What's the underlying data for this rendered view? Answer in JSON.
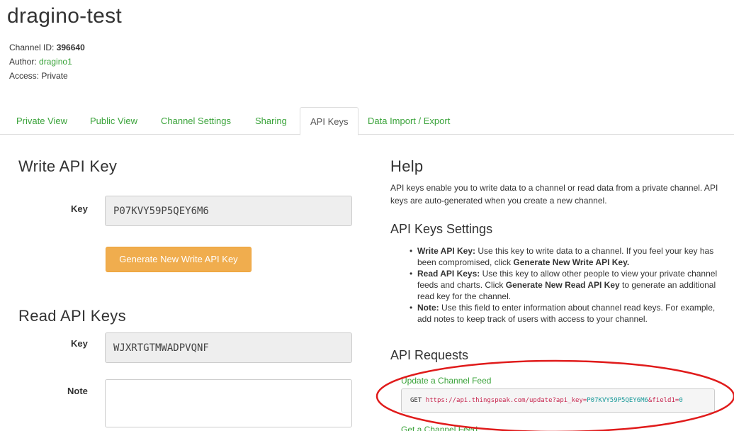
{
  "channel": {
    "name": "dragino-test",
    "id_label": "Channel ID: ",
    "id_value": "396640",
    "author_label": "Author: ",
    "author_value": "dragino1",
    "access_label": "Access: ",
    "access_value": "Private"
  },
  "tabs": [
    {
      "label": "Private View"
    },
    {
      "label": "Public View"
    },
    {
      "label": "Channel Settings"
    },
    {
      "label": "Sharing"
    },
    {
      "label": "API Keys"
    },
    {
      "label": "Data Import / Export"
    }
  ],
  "active_tab": "API Keys",
  "write_key": {
    "heading": "Write API Key",
    "key_label": "Key",
    "key_value": "P07KVY59P5QEY6M6",
    "button_label": "Generate New Write API Key"
  },
  "read_keys": {
    "heading": "Read API Keys",
    "key_label": "Key",
    "key_value": "WJXRTGTMWADPVQNF",
    "note_label": "Note",
    "note_value": ""
  },
  "help": {
    "heading": "Help",
    "intro": "API keys enable you to write data to a channel or read data from a private channel. API keys are auto-generated when you create a new channel.",
    "settings_heading": "API Keys Settings",
    "bullets": [
      {
        "bold": "Write API Key:",
        "text": " Use this key to write data to a channel. If you feel your key has been compromised, click ",
        "bold2": "Generate New Write API Key.",
        "text2": ""
      },
      {
        "bold": "Read API Keys:",
        "text": " Use this key to allow other people to view your private channel feeds and charts. Click ",
        "bold2": "Generate New Read API Key",
        "text2": " to generate an additional read key for the channel."
      },
      {
        "bold": "Note:",
        "text": " Use this field to enter information about channel read keys. For example, add notes to keep track of users with access to your channel.",
        "bold2": "",
        "text2": ""
      }
    ],
    "requests_heading": "API Requests",
    "update_feed_label": "Update a Channel Feed",
    "update_verb": "GET",
    "update_url": "https://api.thingspeak.com/update?api_key=",
    "update_key": "P07KVY59P5QEY6M6",
    "update_param": "&field1=",
    "update_value": "0",
    "get_feed_label": "Get a Channel Feed"
  },
  "colors": {
    "link_green": "#3aa33a",
    "button_orange": "#f0ad4e",
    "annotation_red": "#e01b1b"
  }
}
